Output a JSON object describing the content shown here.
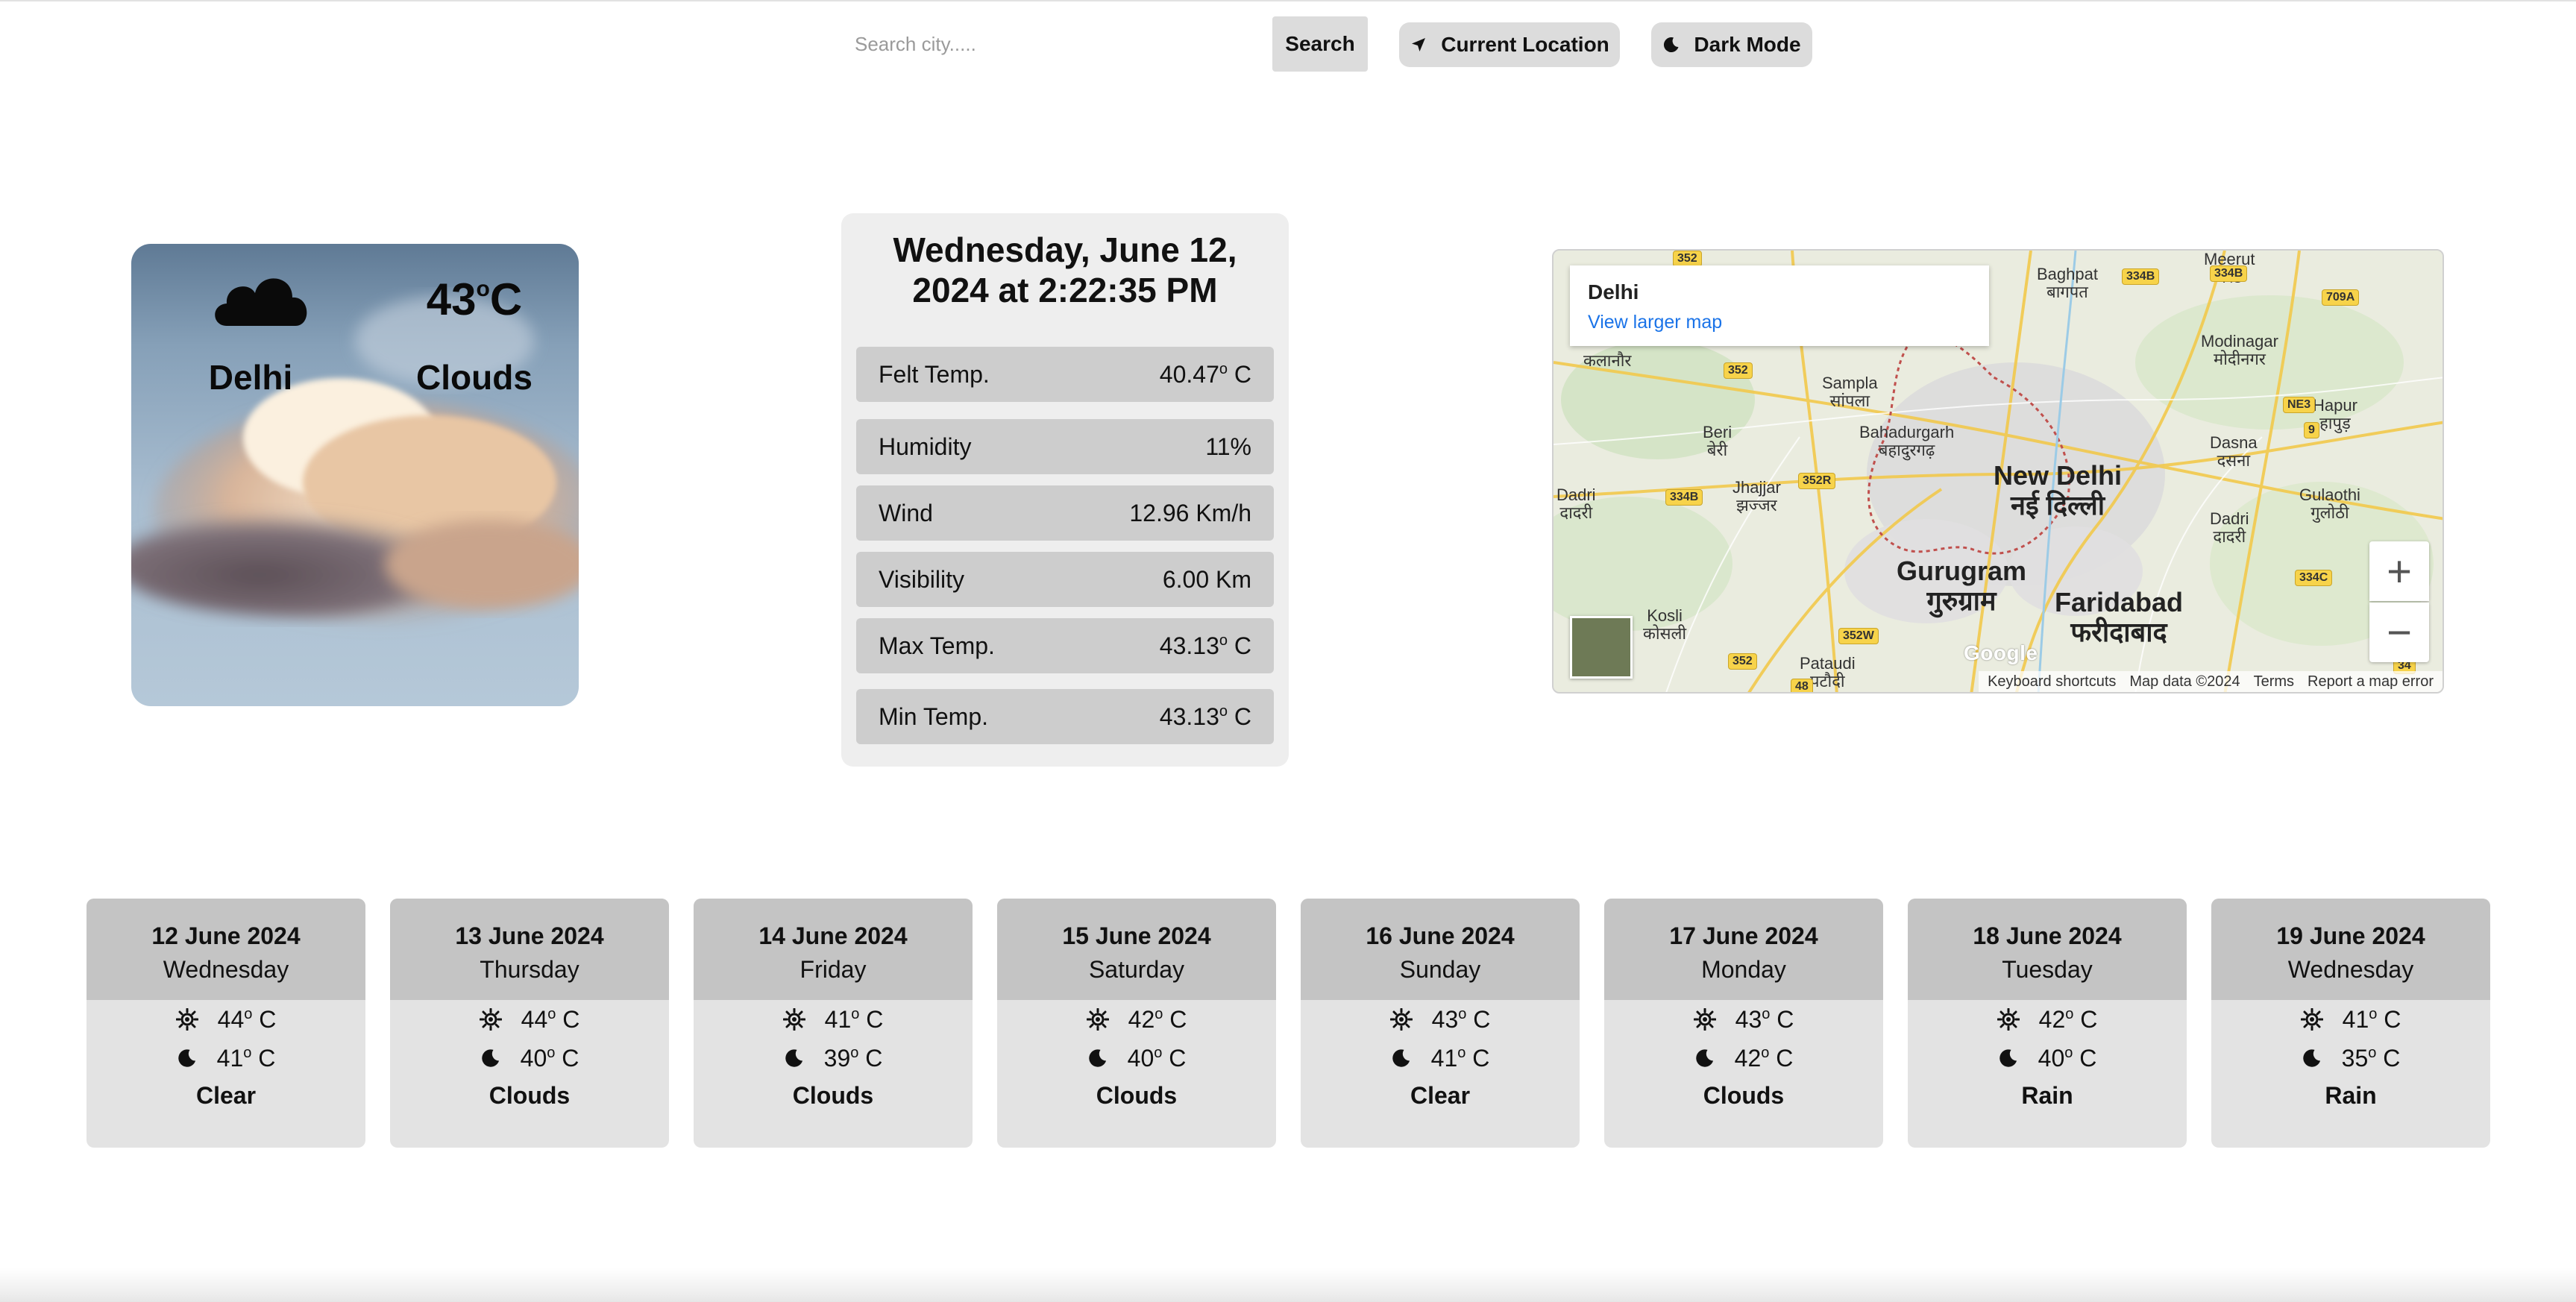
{
  "toolbar": {
    "search_placeholder": "Search city.....",
    "search_label": "Search",
    "location_label": "Current Location",
    "darkmode_label": "Dark Mode"
  },
  "current": {
    "city": "Delhi",
    "temp_value": "43",
    "temp_unit": "C",
    "condition": "Clouds",
    "icon": "cloud-icon"
  },
  "details": {
    "datetime_line1": "Wednesday, June 12,",
    "datetime_line2": "2024 at 2:22:35 PM",
    "rows": [
      {
        "label": "Felt Temp.",
        "value": "40.47",
        "unit": " C",
        "has_deg": true
      },
      {
        "label": "Humidity",
        "value": "11%",
        "unit": "",
        "has_deg": false
      },
      {
        "label": "Wind",
        "value": "12.96 Km/h",
        "unit": "",
        "has_deg": false
      },
      {
        "label": "Visibility",
        "value": "6.00 Km",
        "unit": "",
        "has_deg": false
      },
      {
        "label": "Max Temp.",
        "value": "43.13",
        "unit": " C",
        "has_deg": true
      },
      {
        "label": "Min Temp.",
        "value": "43.13",
        "unit": " C",
        "has_deg": true
      }
    ]
  },
  "map": {
    "place": "Delhi",
    "larger_link": "View larger map",
    "zoom_in": "+",
    "zoom_out": "−",
    "footer": [
      "Keyboard shortcuts",
      "Map data ©2024",
      "Terms",
      "Report a map error"
    ],
    "logo": "Google",
    "labels": {
      "new_delhi": "New Delhi",
      "new_delhi_hi": "नई दिल्ली",
      "gurugram": "Gurugram",
      "gurugram_hi": "गुरुग्राम",
      "faridabad": "Faridabad",
      "faridabad_hi": "फरीदाबाद",
      "baghpat": "Baghpat",
      "baghpat_hi": "बागपत",
      "modinagar": "Modinagar",
      "modinagar_hi": "मोदीनगर",
      "hapur": "Hapur",
      "hapur_hi": "हापुड़",
      "sampla": "Sampla",
      "sampla_hi": "सांपला",
      "bahadurgarh": "Bahadurgarh",
      "bahadurgarh_hi": "बहादुरगढ़",
      "beri": "Beri",
      "beri_hi": "बेरी",
      "jhajjar": "Jhajjar",
      "jhajjar_hi": "झज्जर",
      "dadri": "Dadri",
      "dadri_hi": "दादरी",
      "dasna": "Dasna",
      "dasna_hi": "दसना",
      "gulaothi": "Gulaothi",
      "gulaothi_hi": "गुलोठी",
      "kosli": "Kosli",
      "kosli_hi": "कोसली",
      "pataudi": "Pataudi",
      "pataudi_hi": "पटौदी",
      "meerut": "Meerut",
      "meerut_hi": "मेरठ",
      "kalanaur_hi": "कलानौर",
      "dadri2": "Dadri",
      "dadri2_hi": "दादरी"
    },
    "shields": [
      "352",
      "334B",
      "334B",
      "709A",
      "352",
      "NE3",
      "9",
      "334B",
      "352R",
      "334C",
      "352W",
      "352",
      "48",
      "34"
    ]
  },
  "forecast": [
    {
      "date": "12 June 2024",
      "day": "Wednesday",
      "high": "44",
      "low": "41",
      "cond": "Clear"
    },
    {
      "date": "13 June 2024",
      "day": "Thursday",
      "high": "44",
      "low": "40",
      "cond": "Clouds"
    },
    {
      "date": "14 June 2024",
      "day": "Friday",
      "high": "41",
      "low": "39",
      "cond": "Clouds"
    },
    {
      "date": "15 June 2024",
      "day": "Saturday",
      "high": "42",
      "low": "40",
      "cond": "Clouds"
    },
    {
      "date": "16 June 2024",
      "day": "Sunday",
      "high": "43",
      "low": "41",
      "cond": "Clear"
    },
    {
      "date": "17 June 2024",
      "day": "Monday",
      "high": "43",
      "low": "42",
      "cond": "Clouds"
    },
    {
      "date": "18 June 2024",
      "day": "Tuesday",
      "high": "42",
      "low": "40",
      "cond": "Rain"
    },
    {
      "date": "19 June 2024",
      "day": "Wednesday",
      "high": "41",
      "low": "35",
      "cond": "Rain"
    }
  ],
  "forecast_unit": "C",
  "forecast_deg_symbol": "o",
  "colors": {
    "button_bg": "#dcdcdc",
    "panel_bg": "#eeeeee",
    "row_bg": "#cdcdcd",
    "forecast_head_bg": "#c4c4c4",
    "forecast_body_bg": "#e3e3e3",
    "link": "#1a73e8"
  }
}
